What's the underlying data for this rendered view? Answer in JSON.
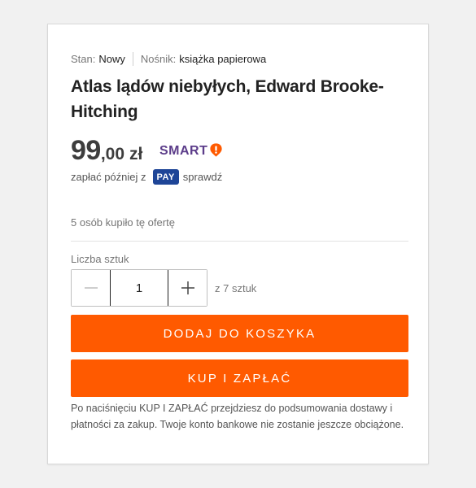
{
  "offer": {
    "condition_label": "Stan:",
    "condition_value": "Nowy",
    "medium_label": "Nośnik:",
    "medium_value": "książka papierowa",
    "title": "Atlas lądów niebyłych, Edward Brooke-Hitching",
    "price_int": "99",
    "price_dec": ",00",
    "currency": "zł",
    "smart_label": "SMART",
    "pay_later_text": "zapłać później z",
    "pay_badge": "PAY",
    "pay_check_link": "sprawdź",
    "bought_text": "5 osób kupiło tę ofertę"
  },
  "quantity": {
    "label": "Liczba sztuk",
    "value": "1",
    "available_text": "z 7 sztuk"
  },
  "actions": {
    "add_to_cart": "DODAJ DO KOSZYKA",
    "buy_and_pay": "KUP I ZAPŁAĆ"
  },
  "note": "Po naciśnięciu KUP I ZAPŁAĆ przejdziesz do podsumowania dostawy i płatności za zakup. Twoje konto bankowe nie zostanie jeszcze obciążone.",
  "colors": {
    "accent": "#ff5a00",
    "smart": "#5c3d8a",
    "pay_badge": "#1e4597"
  },
  "icons": {
    "minus": "minus-icon",
    "plus": "plus-icon",
    "smart_badge": "smart-badge-icon"
  }
}
